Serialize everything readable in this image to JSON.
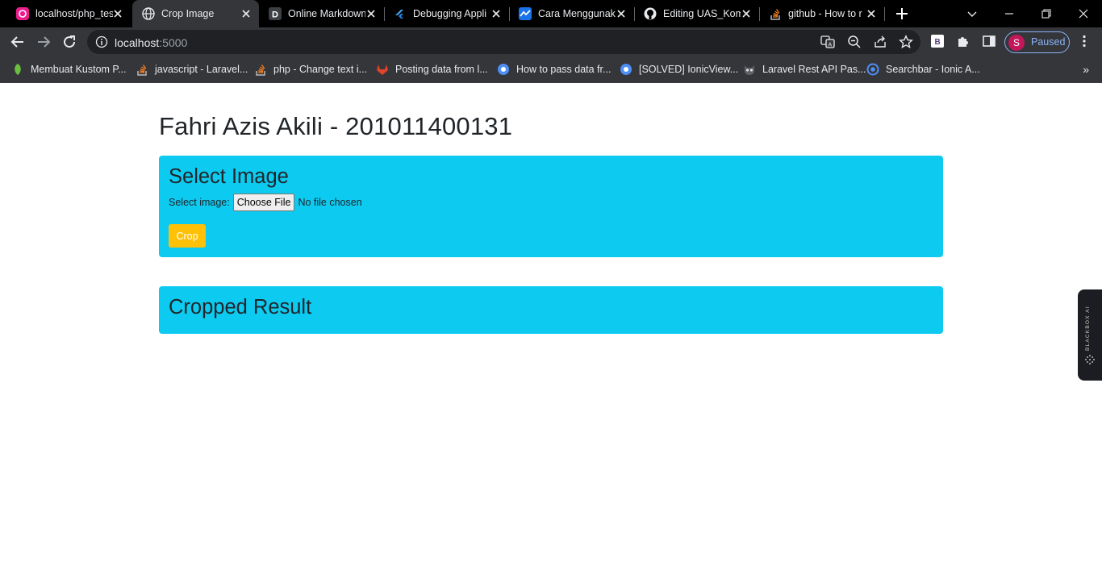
{
  "tabs": [
    {
      "title": "localhost/php_tes",
      "icon": "pink-app-icon",
      "active": false
    },
    {
      "title": "Crop Image",
      "icon": "globe-icon",
      "active": true
    },
    {
      "title": "Online Markdown",
      "icon": "d-logo-icon",
      "active": false
    },
    {
      "title": "Debugging Appli",
      "icon": "flutter-icon",
      "active": false
    },
    {
      "title": "Cara Menggunak",
      "icon": "blue-chart-icon",
      "active": false
    },
    {
      "title": "Editing UAS_Kom",
      "icon": "github-icon",
      "active": false
    },
    {
      "title": "github - How to r",
      "icon": "stackoverflow-icon",
      "active": false
    }
  ],
  "toolbar": {
    "url_host": "localhost",
    "url_port": ":5000",
    "profile_initial": "S",
    "profile_label": "Paused"
  },
  "bookmarks": [
    {
      "label": "Membuat Kustom P...",
      "icon": "leaf-icon"
    },
    {
      "label": "javascript - Laravel...",
      "icon": "stackoverflow-icon"
    },
    {
      "label": "php - Change text i...",
      "icon": "stackoverflow-icon"
    },
    {
      "label": "Posting data from l...",
      "icon": "gitlab-icon"
    },
    {
      "label": "How to pass data fr...",
      "icon": "ionic-icon"
    },
    {
      "label": "[SOLVED] IonicView...",
      "icon": "ionic-icon"
    },
    {
      "label": "Laravel Rest API Pas...",
      "icon": "owl-icon"
    },
    {
      "label": "Searchbar - Ionic A...",
      "icon": "ionic-ring-icon"
    }
  ],
  "page": {
    "heading": "Fahri Azis Akili - 201011400131",
    "select_card": {
      "title": "Select Image",
      "file_label": "Select image:",
      "choose_button": "Choose File",
      "no_file_text": "No file chosen",
      "crop_button": "Crop"
    },
    "result_card": {
      "title": "Cropped Result"
    }
  },
  "side_widget": {
    "label": "BLACKBOX AI"
  },
  "colors": {
    "card_bg": "#0dcaf0",
    "crop_button": "#ffc107",
    "tabstrip": "#000000",
    "toolbar": "#35363a"
  }
}
